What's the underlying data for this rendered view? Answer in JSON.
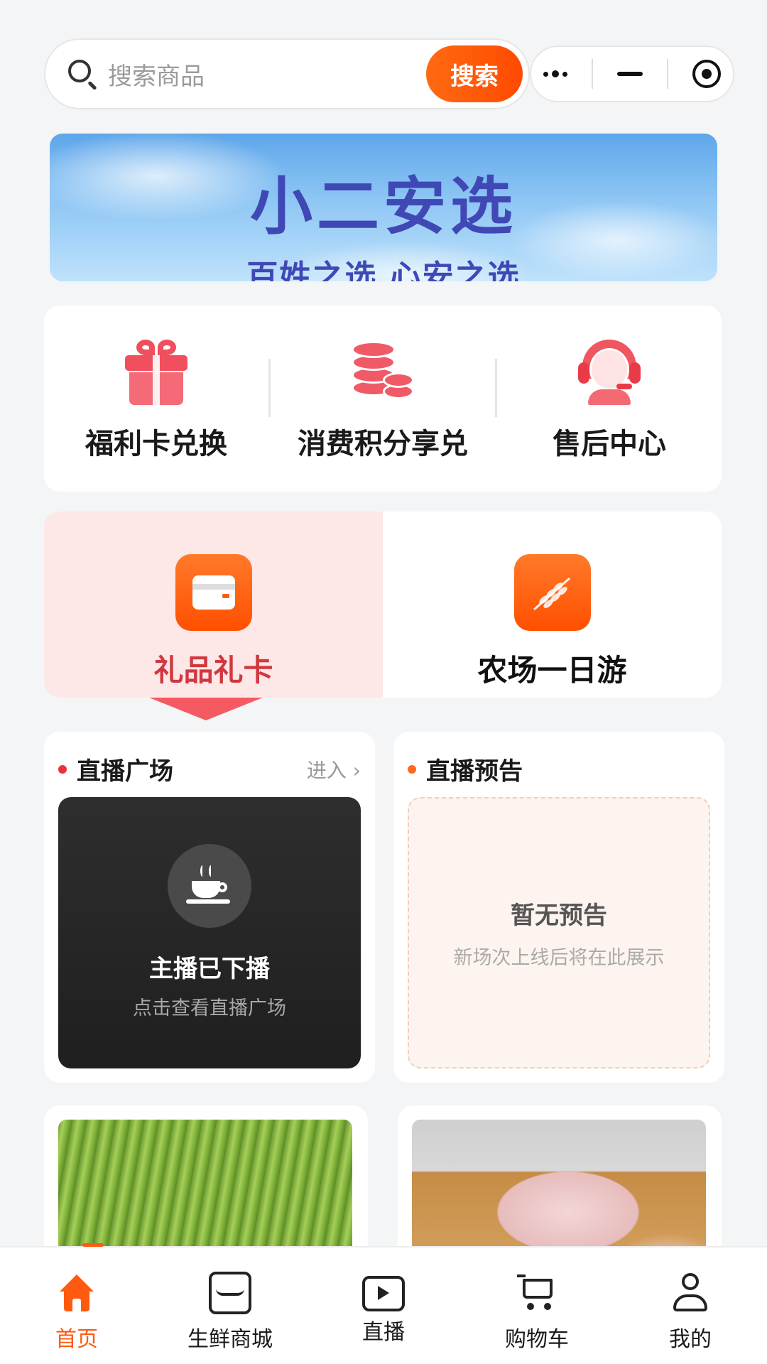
{
  "search": {
    "placeholder": "搜索商品",
    "button_label": "搜索"
  },
  "banner": {
    "title": "小二安选",
    "subtitle": "百姓之选  心安之选"
  },
  "quick_actions": [
    {
      "label": "福利卡兑换",
      "icon": "gift-icon"
    },
    {
      "label": "消费积分享兑",
      "icon": "coins-icon"
    },
    {
      "label": "售后中心",
      "icon": "customer-service-icon"
    }
  ],
  "category_tabs": [
    {
      "label": "礼品礼卡",
      "icon": "gift-card-icon",
      "active": true
    },
    {
      "label": "农场一日游",
      "icon": "wheat-icon",
      "active": false
    }
  ],
  "live_square": {
    "title": "直播广场",
    "enter_label": "进入 ›",
    "status": "主播已下播",
    "hint": "点击查看直播广场"
  },
  "live_preview": {
    "title": "直播预告",
    "empty": "暂无预告",
    "hint": "新场次上线后将在此展示"
  },
  "products": [
    {
      "image": "green-beans-photo"
    },
    {
      "image": "pork-trotter-photo"
    }
  ],
  "tabbar": [
    {
      "label": "首页",
      "icon": "home-icon",
      "active": true
    },
    {
      "label": "生鲜商城",
      "icon": "store-icon",
      "active": false
    },
    {
      "label": "直播",
      "icon": "tv-play-icon",
      "active": false
    },
    {
      "label": "购物车",
      "icon": "cart-icon",
      "active": false
    },
    {
      "label": "我的",
      "icon": "user-icon",
      "active": false
    }
  ],
  "colors": {
    "accent": "#ff5a10",
    "banner_text": "#3f48b5",
    "active_tab_text": "#d0383f"
  }
}
